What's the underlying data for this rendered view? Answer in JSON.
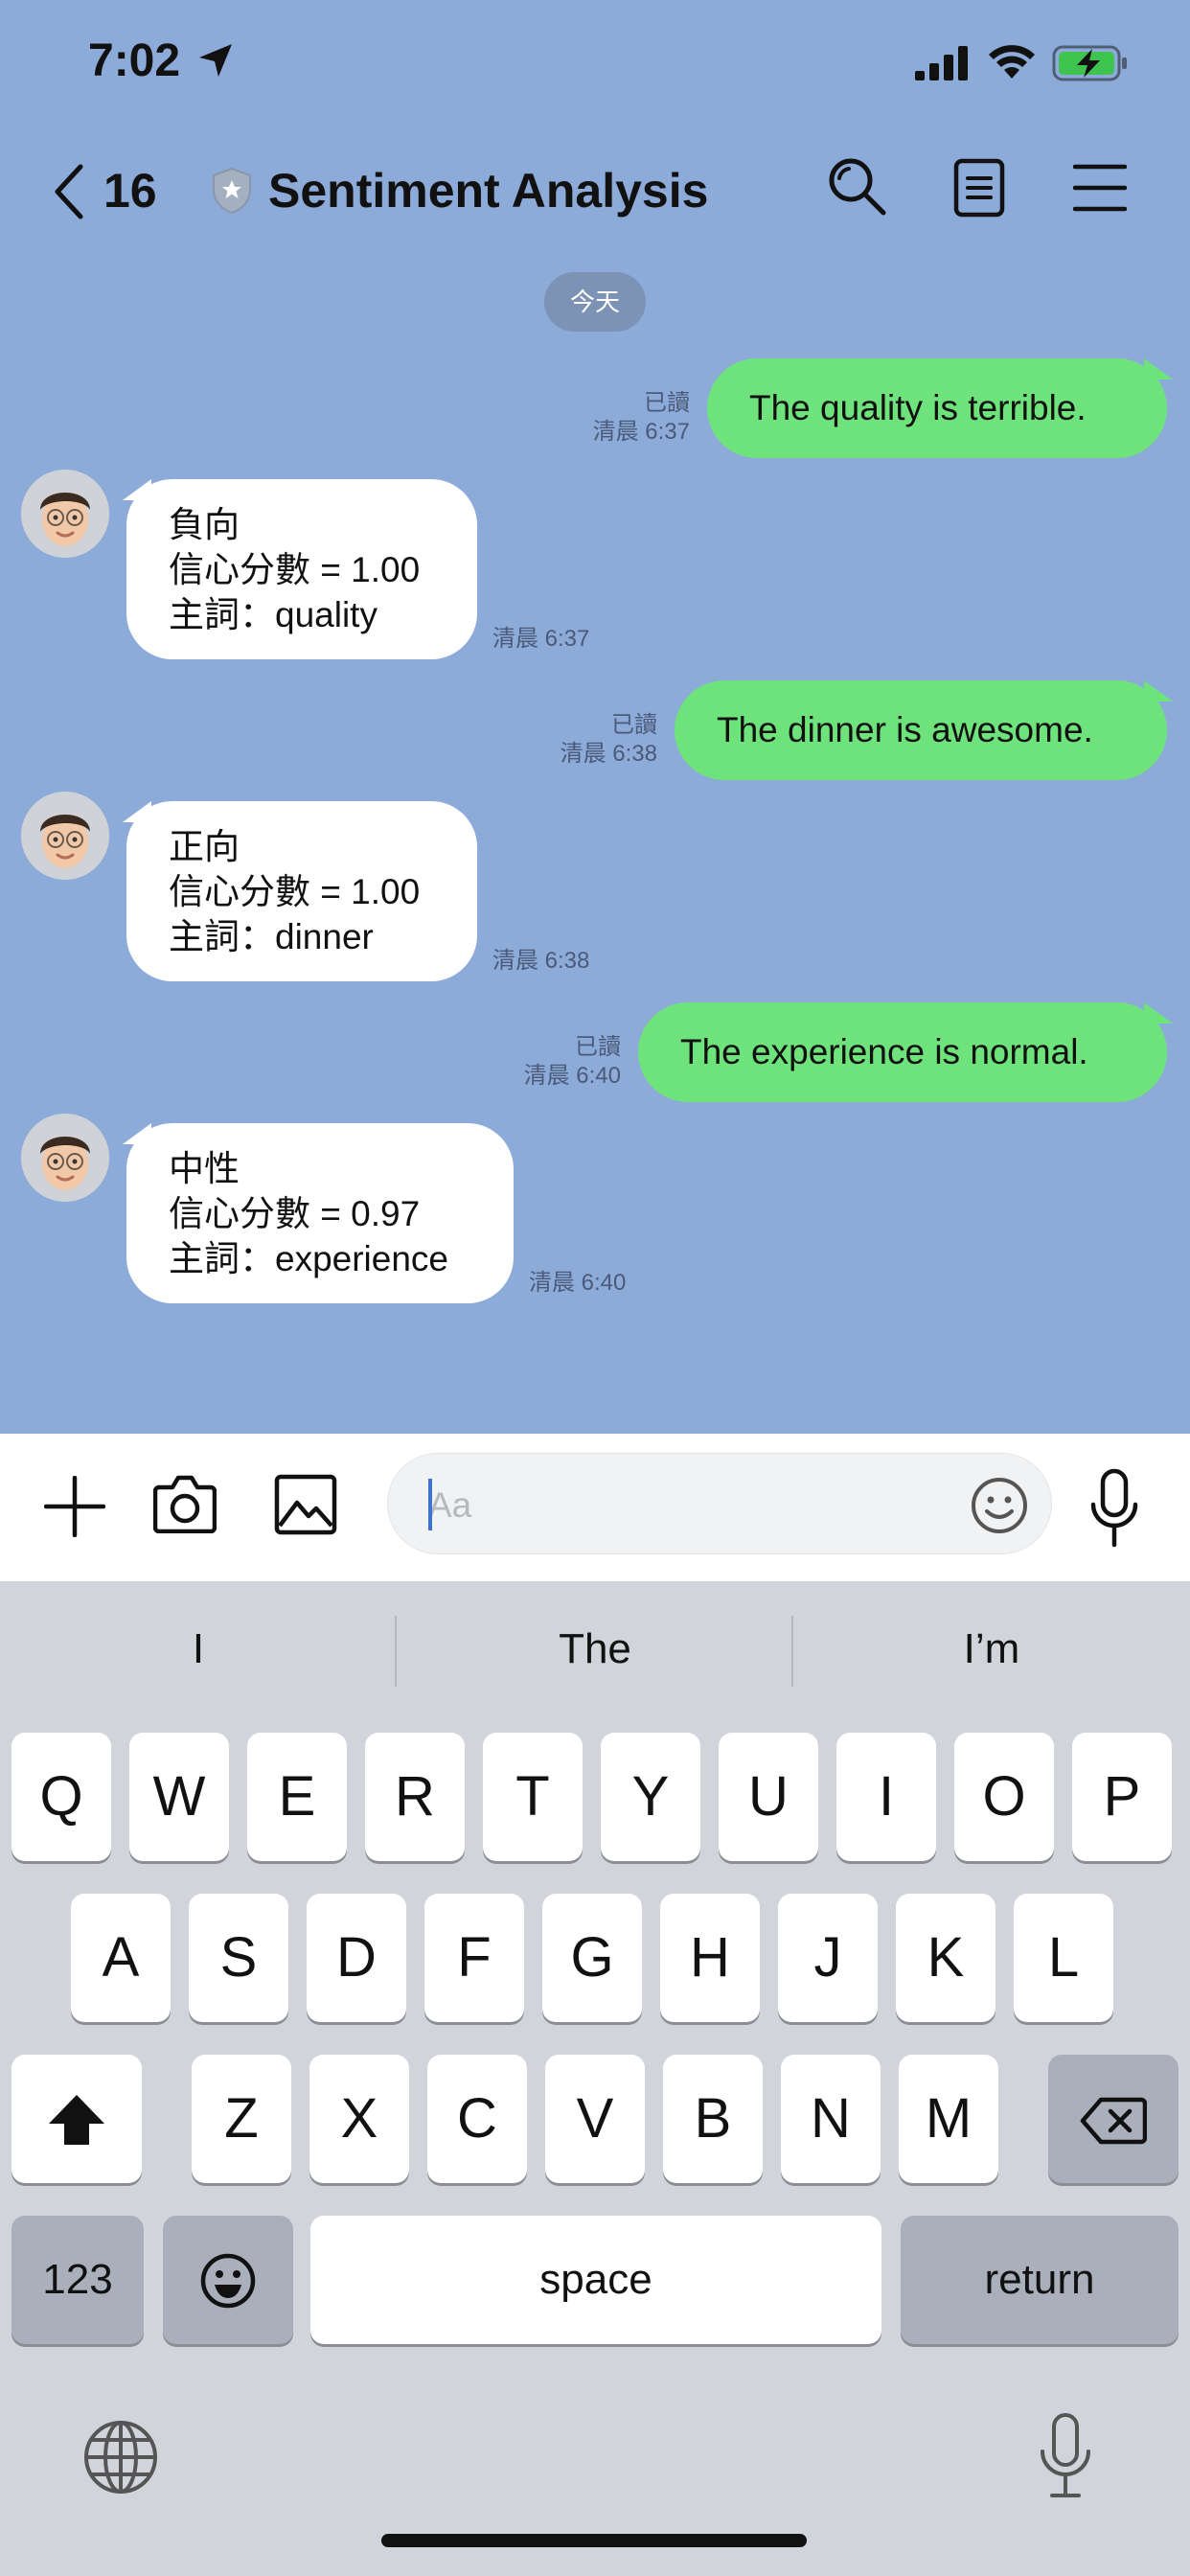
{
  "status_bar": {
    "time": "7:02"
  },
  "header": {
    "back_count": "16",
    "title": "Sentiment Analysis"
  },
  "date_divider": "今天",
  "messages": [
    {
      "dir": "out",
      "read": "已讀",
      "time": "清晨 6:37",
      "text": "The quality is terrible."
    },
    {
      "dir": "in",
      "lines": [
        "負向",
        "信心分數 = 1.00",
        "主詞：quality"
      ],
      "time": "清晨 6:37"
    },
    {
      "dir": "out",
      "read": "已讀",
      "time": "清晨 6:38",
      "text": "The dinner is awesome."
    },
    {
      "dir": "in",
      "lines": [
        "正向",
        "信心分數 = 1.00",
        "主詞：dinner"
      ],
      "time": "清晨 6:38"
    },
    {
      "dir": "out",
      "read": "已讀",
      "time": "清晨 6:40",
      "text": "The experience is normal."
    },
    {
      "dir": "in",
      "lines": [
        "中性",
        "信心分數 = 0.97",
        "主詞：experience"
      ],
      "time": "清晨 6:40"
    }
  ],
  "input": {
    "placeholder": "Aa"
  },
  "keyboard": {
    "suggestions": [
      "I",
      "The",
      "I’m"
    ],
    "row1": [
      "Q",
      "W",
      "E",
      "R",
      "T",
      "Y",
      "U",
      "I",
      "O",
      "P"
    ],
    "row2": [
      "A",
      "S",
      "D",
      "F",
      "G",
      "H",
      "J",
      "K",
      "L"
    ],
    "row3": [
      "Z",
      "X",
      "C",
      "V",
      "B",
      "N",
      "M"
    ],
    "numbers_label": "123",
    "space_label": "space",
    "return_label": "return"
  }
}
